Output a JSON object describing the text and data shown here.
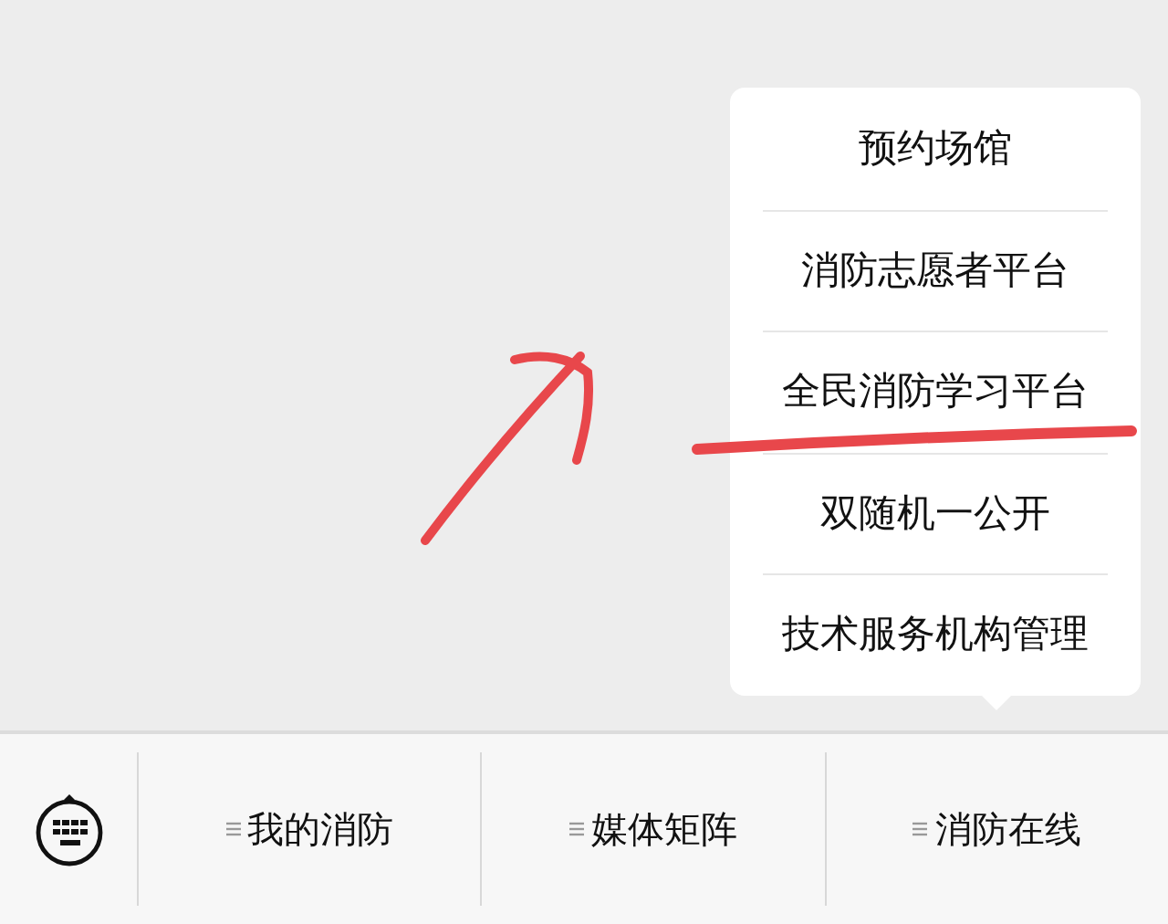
{
  "menu_bar": {
    "items": [
      {
        "label": "我的消防"
      },
      {
        "label": "媒体矩阵"
      },
      {
        "label": "消防在线",
        "submenu": [
          "预约场馆",
          "消防志愿者平台",
          "全民消防学习平台",
          "双随机一公开",
          "技术服务机构管理"
        ]
      }
    ]
  }
}
